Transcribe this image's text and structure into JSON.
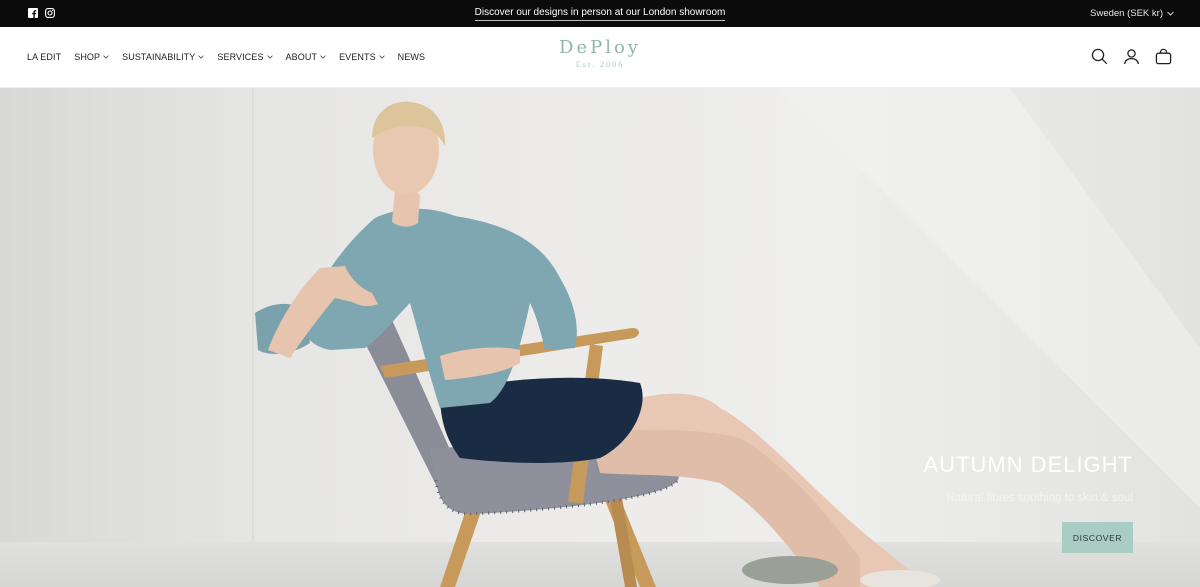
{
  "topbar": {
    "social": [
      {
        "icon": "facebook-icon"
      },
      {
        "icon": "instagram-icon"
      }
    ],
    "announcement": "Discover our designs in person at our London showroom",
    "locale": "Sweden (SEK kr)"
  },
  "header": {
    "nav": [
      {
        "label": "LA EDIT",
        "has_dropdown": false
      },
      {
        "label": "SHOP",
        "has_dropdown": true
      },
      {
        "label": "SUSTAINABILITY",
        "has_dropdown": true
      },
      {
        "label": "SERVICES",
        "has_dropdown": true
      },
      {
        "label": "ABOUT",
        "has_dropdown": true
      },
      {
        "label": "EVENTS",
        "has_dropdown": true
      },
      {
        "label": "NEWS",
        "has_dropdown": false
      }
    ],
    "logo": {
      "name": "DePloy",
      "tagline": "Est. 2006"
    },
    "icons": [
      "search-icon",
      "account-icon",
      "cart-icon"
    ]
  },
  "hero": {
    "title": "AUTUMN DELIGHT",
    "subtitle": "Natural fibres soothing to skin & soul",
    "button": "DISCOVER"
  },
  "colors": {
    "brand": "#8fb6ac",
    "button_bg": "#a9cdc2",
    "topbar_bg": "#0b0b0b",
    "blouse": "#7fa7b1",
    "chair_fabric": "#8a8d98",
    "chair_wood": "#c79a5b"
  }
}
